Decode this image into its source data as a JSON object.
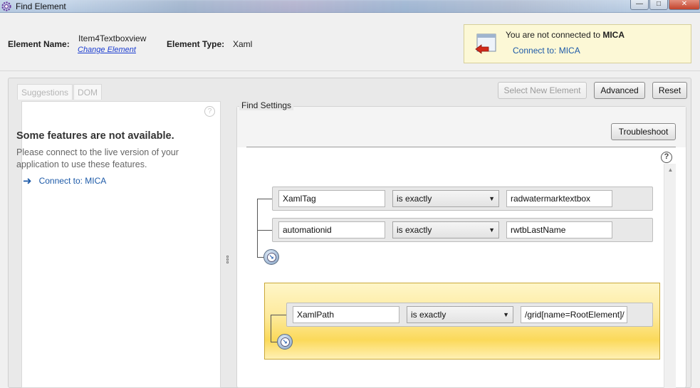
{
  "window": {
    "title": "Find Element",
    "controls": [
      "minimize",
      "maximize",
      "close"
    ]
  },
  "header": {
    "element_name_label": "Element Name:",
    "element_name_value": "Item4Textboxview",
    "change_element_link": "Change Element",
    "element_type_label": "Element Type:",
    "element_type_value": "Xaml"
  },
  "mica_notice": {
    "message_prefix": "You are not connected to ",
    "message_bold": "MICA",
    "link": "Connect to: MICA"
  },
  "left_panel": {
    "tabs": [
      "Suggestions",
      "DOM"
    ],
    "not_available_title": "Some features are not available.",
    "not_available_desc": "Please connect to the live version of your application to use these features.",
    "connect_link": "Connect to: MICA"
  },
  "toolbar": {
    "select_new_element": "Select New Element",
    "advanced": "Advanced",
    "reset": "Reset"
  },
  "find_settings": {
    "legend": "Find Settings",
    "troubleshoot": "Troubleshoot",
    "help_glyph": "?",
    "criteria": [
      {
        "attribute": "XamlTag",
        "operator": "is exactly",
        "value": "radwatermarktextbox"
      },
      {
        "attribute": "automationid",
        "operator": "is exactly",
        "value": "rwtbLastName"
      }
    ],
    "highlighted_criteria": [
      {
        "attribute": "XamlPath",
        "operator": "is exactly",
        "value": "/grid[name=RootElement]/"
      }
    ]
  }
}
